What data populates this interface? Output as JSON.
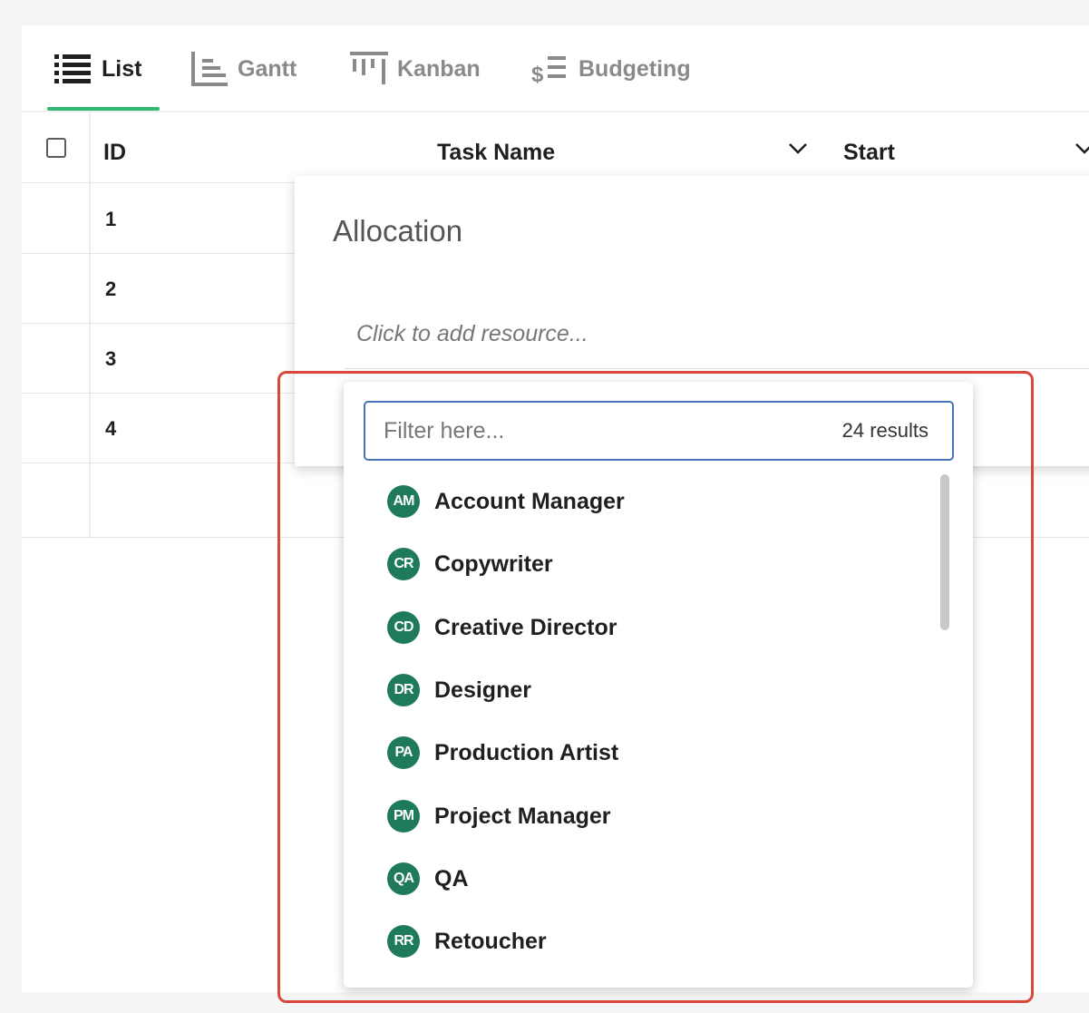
{
  "tabs": [
    {
      "label": "List",
      "icon": "list-icon",
      "active": true
    },
    {
      "label": "Gantt",
      "icon": "gantt-icon",
      "active": false
    },
    {
      "label": "Kanban",
      "icon": "kanban-icon",
      "active": false
    },
    {
      "label": "Budgeting",
      "icon": "budgeting-icon",
      "active": false
    }
  ],
  "grid": {
    "columns": [
      "ID",
      "Task Name",
      "Start"
    ],
    "rows": [
      {
        "id": "1"
      },
      {
        "id": "2"
      },
      {
        "id": "3"
      },
      {
        "id": "4"
      }
    ]
  },
  "allocation": {
    "title": "Allocation",
    "placeholder": "Click to add resource..."
  },
  "dropdown": {
    "filter_placeholder": "Filter here...",
    "result_count": "24 results",
    "options": [
      {
        "initials": "AM",
        "label": "Account Manager"
      },
      {
        "initials": "CR",
        "label": "Copywriter"
      },
      {
        "initials": "CD",
        "label": "Creative Director"
      },
      {
        "initials": "DR",
        "label": "Designer"
      },
      {
        "initials": "PA",
        "label": "Production Artist"
      },
      {
        "initials": "PM",
        "label": "Project Manager"
      },
      {
        "initials": "QA",
        "label": "QA"
      },
      {
        "initials": "RR",
        "label": "Retoucher"
      }
    ]
  },
  "colors": {
    "active_tab_underline": "#2eb872",
    "avatar_bg": "#1f7a5a",
    "filter_border": "#4a72b8",
    "highlight_border": "#d9473a"
  }
}
